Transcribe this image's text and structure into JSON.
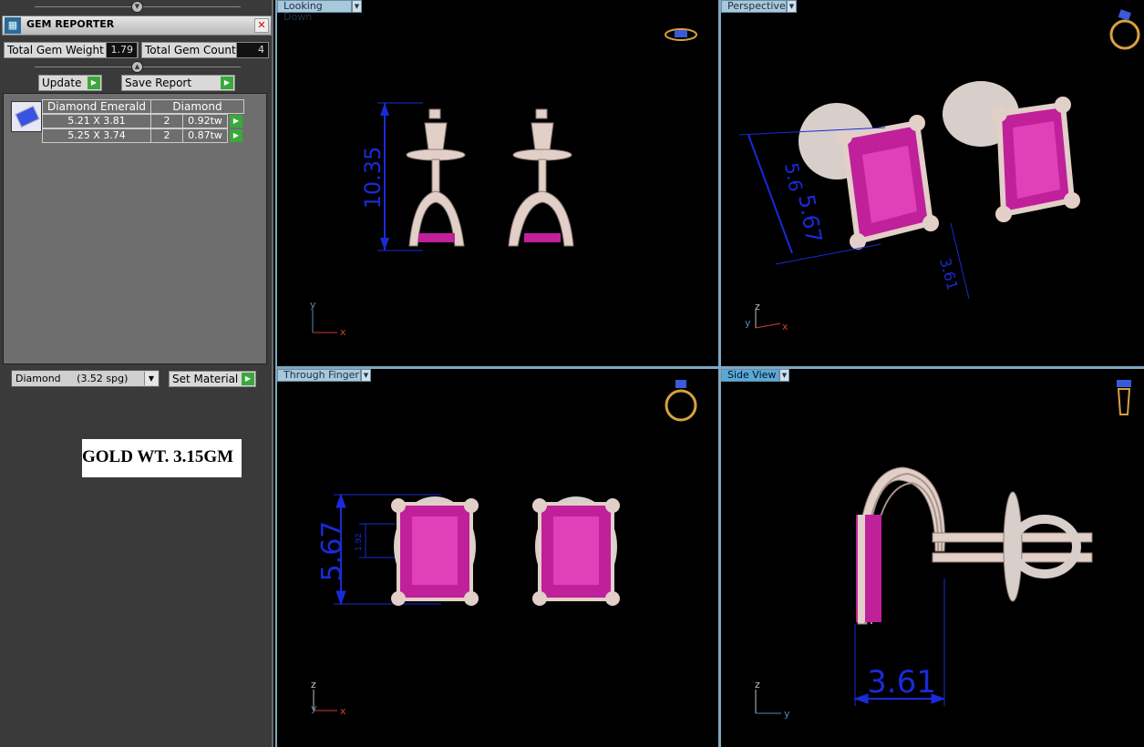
{
  "panel": {
    "title": "GEM REPORTER",
    "close_glyph": "✕",
    "total_weight_label": "Total Gem Weight",
    "total_weight_value": "1.79",
    "total_count_label": "Total Gem Count",
    "total_count_value": "4",
    "update_label": "Update",
    "save_report_label": "Save Report",
    "table": {
      "headers": [
        "Diamond Emerald",
        "Diamond"
      ],
      "rows": [
        {
          "size": "5.21 X 3.81",
          "count": "2",
          "weight": "0.92tw"
        },
        {
          "size": "5.25 X 3.74",
          "count": "2",
          "weight": "0.87tw"
        }
      ]
    },
    "material_select": "Diamond     (3.52 spg)",
    "set_material_label": "Set Material",
    "gold_weight": "GOLD WT. 3.15GM"
  },
  "viewports": {
    "top_left": {
      "label": "Looking Down",
      "dimension": "10.35",
      "axes": [
        "y",
        "x"
      ]
    },
    "top_right": {
      "label": "Perspective",
      "dimension_a": "5.67",
      "dimension_b": "5.6",
      "dimension_c": "3.61",
      "axes": [
        "z",
        "y",
        "x"
      ]
    },
    "bottom_left": {
      "label": "Through Finger",
      "dimension_a": "5.67",
      "dimension_b": "1.92",
      "axes": [
        "z",
        "y",
        "x"
      ]
    },
    "bottom_right": {
      "label": "Side View",
      "dimension": "3.61",
      "axes": [
        "z",
        "y"
      ]
    }
  },
  "colors": {
    "metal": "#e2cfc8",
    "gem": "#c0209a",
    "dimension": "#1a2ad8",
    "active_tab": "#5aa8d8"
  },
  "icons": [
    "gem-reporter-icon",
    "close-icon",
    "play-arrow-icon",
    "ring-view-icon",
    "earring-view-icon",
    "dropdown-arrow-icon"
  ]
}
